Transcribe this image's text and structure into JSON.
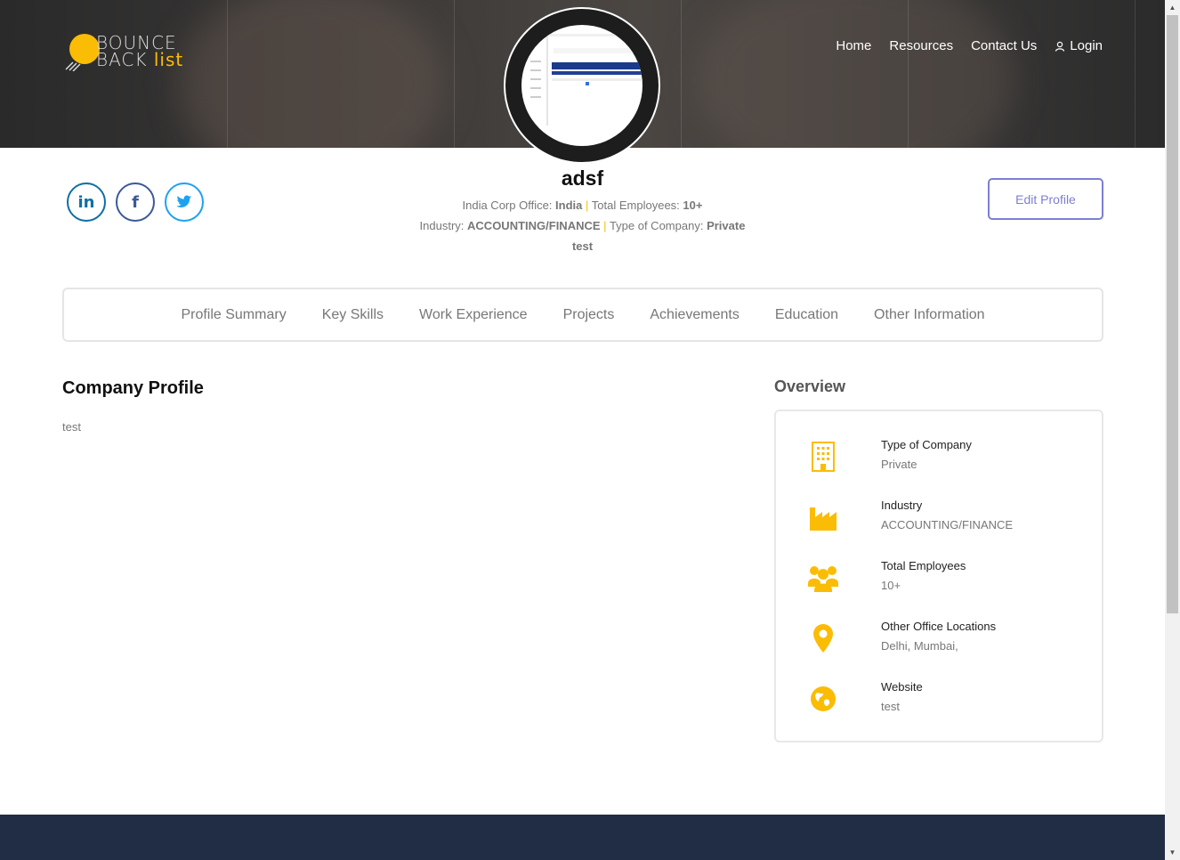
{
  "header": {
    "logo": {
      "line1": "BOUNCE",
      "line2_a": "BACK",
      "line2_b": "list"
    },
    "nav": [
      "Home",
      "Resources",
      "Contact Us",
      "Login"
    ]
  },
  "profile": {
    "name": "adsf",
    "office_label": "India Corp Office:",
    "office_value": "India",
    "employees_label": "Total Employees:",
    "employees_value": "10+",
    "industry_label": "Industry:",
    "industry_value": "ACCOUNTING/FINANCE",
    "company_type_label": "Type of Company:",
    "company_type_value": "Private",
    "tagline": "test",
    "separator": "|",
    "edit_label": "Edit Profile",
    "socials": {
      "linkedin": "in",
      "facebook": "f"
    }
  },
  "tabs": [
    "Profile Summary",
    "Key Skills",
    "Work Experience",
    "Projects",
    "Achievements",
    "Education",
    "Other Information"
  ],
  "company_profile": {
    "title": "Company Profile",
    "text": "test"
  },
  "overview": {
    "title": "Overview",
    "items": [
      {
        "label": "Type of Company",
        "value": "Private",
        "icon": "building-icon"
      },
      {
        "label": "Industry",
        "value": "ACCOUNTING/FINANCE",
        "icon": "factory-icon"
      },
      {
        "label": "Total Employees",
        "value": "10+",
        "icon": "group-icon"
      },
      {
        "label": "Other Office Locations",
        "value": "Delhi, Mumbai,",
        "icon": "location-pin-icon"
      },
      {
        "label": "Website",
        "value": "test",
        "icon": "globe-icon"
      }
    ]
  },
  "colors": {
    "accent": "#fbbc05",
    "footer": "#212d45",
    "edit_button": "#7c7fd1"
  }
}
